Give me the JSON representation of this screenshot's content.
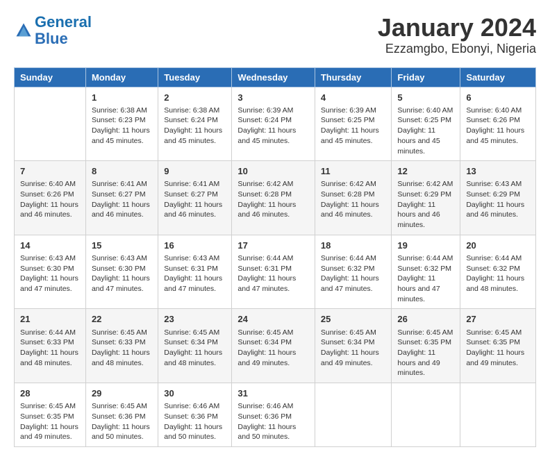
{
  "logo": {
    "line1": "General",
    "line2": "Blue"
  },
  "title": "January 2024",
  "subtitle": "Ezzamgbo, Ebonyi, Nigeria",
  "days_of_week": [
    "Sunday",
    "Monday",
    "Tuesday",
    "Wednesday",
    "Thursday",
    "Friday",
    "Saturday"
  ],
  "weeks": [
    [
      {
        "day": "",
        "sunrise": "",
        "sunset": "",
        "daylight": ""
      },
      {
        "day": "1",
        "sunrise": "Sunrise: 6:38 AM",
        "sunset": "Sunset: 6:23 PM",
        "daylight": "Daylight: 11 hours and 45 minutes."
      },
      {
        "day": "2",
        "sunrise": "Sunrise: 6:38 AM",
        "sunset": "Sunset: 6:24 PM",
        "daylight": "Daylight: 11 hours and 45 minutes."
      },
      {
        "day": "3",
        "sunrise": "Sunrise: 6:39 AM",
        "sunset": "Sunset: 6:24 PM",
        "daylight": "Daylight: 11 hours and 45 minutes."
      },
      {
        "day": "4",
        "sunrise": "Sunrise: 6:39 AM",
        "sunset": "Sunset: 6:25 PM",
        "daylight": "Daylight: 11 hours and 45 minutes."
      },
      {
        "day": "5",
        "sunrise": "Sunrise: 6:40 AM",
        "sunset": "Sunset: 6:25 PM",
        "daylight": "Daylight: 11 hours and 45 minutes."
      },
      {
        "day": "6",
        "sunrise": "Sunrise: 6:40 AM",
        "sunset": "Sunset: 6:26 PM",
        "daylight": "Daylight: 11 hours and 45 minutes."
      }
    ],
    [
      {
        "day": "7",
        "sunrise": "Sunrise: 6:40 AM",
        "sunset": "Sunset: 6:26 PM",
        "daylight": "Daylight: 11 hours and 46 minutes."
      },
      {
        "day": "8",
        "sunrise": "Sunrise: 6:41 AM",
        "sunset": "Sunset: 6:27 PM",
        "daylight": "Daylight: 11 hours and 46 minutes."
      },
      {
        "day": "9",
        "sunrise": "Sunrise: 6:41 AM",
        "sunset": "Sunset: 6:27 PM",
        "daylight": "Daylight: 11 hours and 46 minutes."
      },
      {
        "day": "10",
        "sunrise": "Sunrise: 6:42 AM",
        "sunset": "Sunset: 6:28 PM",
        "daylight": "Daylight: 11 hours and 46 minutes."
      },
      {
        "day": "11",
        "sunrise": "Sunrise: 6:42 AM",
        "sunset": "Sunset: 6:28 PM",
        "daylight": "Daylight: 11 hours and 46 minutes."
      },
      {
        "day": "12",
        "sunrise": "Sunrise: 6:42 AM",
        "sunset": "Sunset: 6:29 PM",
        "daylight": "Daylight: 11 hours and 46 minutes."
      },
      {
        "day": "13",
        "sunrise": "Sunrise: 6:43 AM",
        "sunset": "Sunset: 6:29 PM",
        "daylight": "Daylight: 11 hours and 46 minutes."
      }
    ],
    [
      {
        "day": "14",
        "sunrise": "Sunrise: 6:43 AM",
        "sunset": "Sunset: 6:30 PM",
        "daylight": "Daylight: 11 hours and 47 minutes."
      },
      {
        "day": "15",
        "sunrise": "Sunrise: 6:43 AM",
        "sunset": "Sunset: 6:30 PM",
        "daylight": "Daylight: 11 hours and 47 minutes."
      },
      {
        "day": "16",
        "sunrise": "Sunrise: 6:43 AM",
        "sunset": "Sunset: 6:31 PM",
        "daylight": "Daylight: 11 hours and 47 minutes."
      },
      {
        "day": "17",
        "sunrise": "Sunrise: 6:44 AM",
        "sunset": "Sunset: 6:31 PM",
        "daylight": "Daylight: 11 hours and 47 minutes."
      },
      {
        "day": "18",
        "sunrise": "Sunrise: 6:44 AM",
        "sunset": "Sunset: 6:32 PM",
        "daylight": "Daylight: 11 hours and 47 minutes."
      },
      {
        "day": "19",
        "sunrise": "Sunrise: 6:44 AM",
        "sunset": "Sunset: 6:32 PM",
        "daylight": "Daylight: 11 hours and 47 minutes."
      },
      {
        "day": "20",
        "sunrise": "Sunrise: 6:44 AM",
        "sunset": "Sunset: 6:32 PM",
        "daylight": "Daylight: 11 hours and 48 minutes."
      }
    ],
    [
      {
        "day": "21",
        "sunrise": "Sunrise: 6:44 AM",
        "sunset": "Sunset: 6:33 PM",
        "daylight": "Daylight: 11 hours and 48 minutes."
      },
      {
        "day": "22",
        "sunrise": "Sunrise: 6:45 AM",
        "sunset": "Sunset: 6:33 PM",
        "daylight": "Daylight: 11 hours and 48 minutes."
      },
      {
        "day": "23",
        "sunrise": "Sunrise: 6:45 AM",
        "sunset": "Sunset: 6:34 PM",
        "daylight": "Daylight: 11 hours and 48 minutes."
      },
      {
        "day": "24",
        "sunrise": "Sunrise: 6:45 AM",
        "sunset": "Sunset: 6:34 PM",
        "daylight": "Daylight: 11 hours and 49 minutes."
      },
      {
        "day": "25",
        "sunrise": "Sunrise: 6:45 AM",
        "sunset": "Sunset: 6:34 PM",
        "daylight": "Daylight: 11 hours and 49 minutes."
      },
      {
        "day": "26",
        "sunrise": "Sunrise: 6:45 AM",
        "sunset": "Sunset: 6:35 PM",
        "daylight": "Daylight: 11 hours and 49 minutes."
      },
      {
        "day": "27",
        "sunrise": "Sunrise: 6:45 AM",
        "sunset": "Sunset: 6:35 PM",
        "daylight": "Daylight: 11 hours and 49 minutes."
      }
    ],
    [
      {
        "day": "28",
        "sunrise": "Sunrise: 6:45 AM",
        "sunset": "Sunset: 6:35 PM",
        "daylight": "Daylight: 11 hours and 49 minutes."
      },
      {
        "day": "29",
        "sunrise": "Sunrise: 6:45 AM",
        "sunset": "Sunset: 6:36 PM",
        "daylight": "Daylight: 11 hours and 50 minutes."
      },
      {
        "day": "30",
        "sunrise": "Sunrise: 6:46 AM",
        "sunset": "Sunset: 6:36 PM",
        "daylight": "Daylight: 11 hours and 50 minutes."
      },
      {
        "day": "31",
        "sunrise": "Sunrise: 6:46 AM",
        "sunset": "Sunset: 6:36 PM",
        "daylight": "Daylight: 11 hours and 50 minutes."
      },
      {
        "day": "",
        "sunrise": "",
        "sunset": "",
        "daylight": ""
      },
      {
        "day": "",
        "sunrise": "",
        "sunset": "",
        "daylight": ""
      },
      {
        "day": "",
        "sunrise": "",
        "sunset": "",
        "daylight": ""
      }
    ]
  ]
}
